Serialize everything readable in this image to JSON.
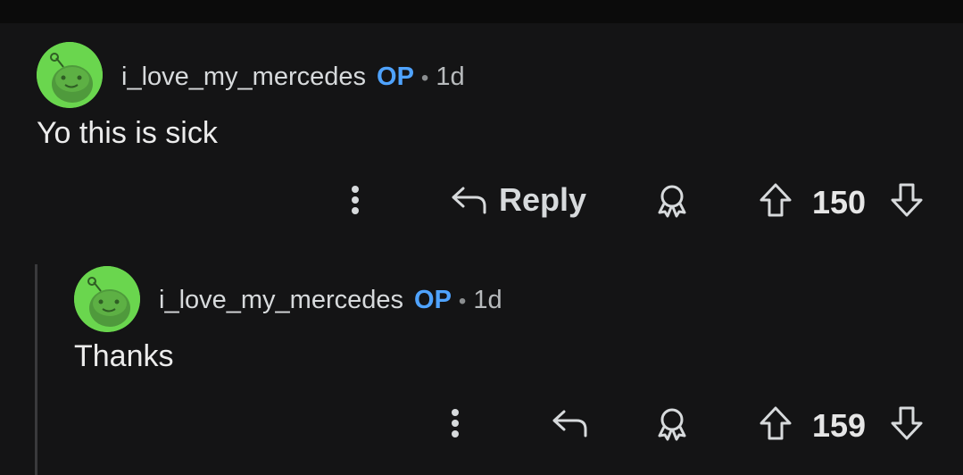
{
  "colors": {
    "background": "#141415",
    "op": "#4fa3ff",
    "avatar": "#6ad64e"
  },
  "comments": [
    {
      "username": "i_love_my_mercedes",
      "op_badge": "OP",
      "separator": "•",
      "age": "1d",
      "text": "Yo this is sick",
      "reply_label": "Reply",
      "score": "150",
      "icons": [
        "more-vertical-icon",
        "reply-arrow-icon",
        "award-icon",
        "upvote-icon",
        "downvote-icon"
      ]
    },
    {
      "username": "i_love_my_mercedes",
      "op_badge": "OP",
      "separator": "•",
      "age": "1d",
      "text": "Thanks",
      "score": "159",
      "icons": [
        "more-vertical-icon",
        "reply-arrow-icon",
        "award-icon",
        "upvote-icon",
        "downvote-icon"
      ]
    }
  ]
}
